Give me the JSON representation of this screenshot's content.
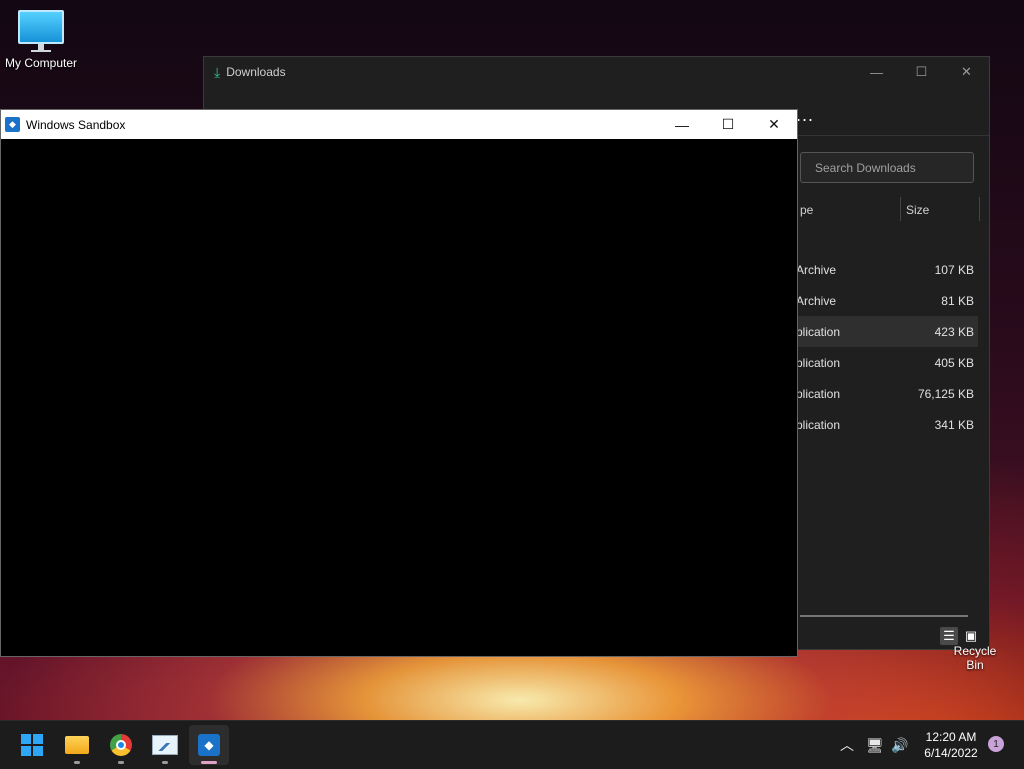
{
  "desktop": {
    "icons": [
      {
        "label": "My Computer"
      },
      {
        "label": "Recycle Bin"
      }
    ]
  },
  "downloads": {
    "title": "Downloads",
    "search_placeholder": "Search Downloads",
    "columns": {
      "type": "pe",
      "size": "Size"
    },
    "rows": [
      {
        "type": "Archive",
        "size": "107 KB",
        "selected": false
      },
      {
        "type": "Archive",
        "size": "81 KB",
        "selected": false
      },
      {
        "type": "plication",
        "size": "423 KB",
        "selected": true
      },
      {
        "type": "plication",
        "size": "405 KB",
        "selected": false
      },
      {
        "type": "plication",
        "size": "76,125 KB",
        "selected": false
      },
      {
        "type": "plication",
        "size": "341 KB",
        "selected": false
      }
    ],
    "more_label": "..."
  },
  "sandbox": {
    "title": "Windows Sandbox"
  },
  "taskbar": {
    "apps": [
      "start-icon",
      "file-explorer-icon",
      "chrome-icon",
      "resource-monitor-icon",
      "windows-sandbox-icon"
    ],
    "clock_time": "12:20 AM",
    "clock_date": "6/14/2022",
    "notification_count": "1"
  },
  "colors": {
    "accent": "#2fa6f5",
    "sandbox_blue": "#1a73c8"
  }
}
